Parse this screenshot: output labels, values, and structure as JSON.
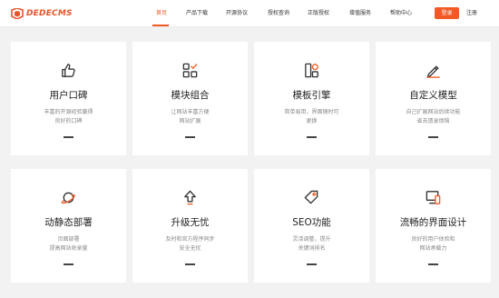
{
  "header": {
    "logo_text": "DEDECMS",
    "nav": [
      {
        "label": "首页",
        "active": true
      },
      {
        "label": "产品下载",
        "active": false
      },
      {
        "label": "开源协议",
        "active": false
      },
      {
        "label": "授权查询",
        "active": false
      },
      {
        "label": "正版授权",
        "active": false
      },
      {
        "label": "增值服务",
        "active": false
      },
      {
        "label": "帮助中心",
        "active": false
      }
    ],
    "login_label": "登录",
    "register_label": "注册"
  },
  "colors": {
    "accent": "#f15a24",
    "logo": "#e8542c",
    "background": "#f2f2f3",
    "card": "#ffffff"
  },
  "features": [
    {
      "icon": "thumbs-up-icon",
      "title": "用户口碑",
      "desc1": "丰富的开源经验赢得",
      "desc2": "良好的口碑"
    },
    {
      "icon": "modules-icon",
      "title": "模块组合",
      "desc1": "让网站丰富方便",
      "desc2": "网站扩展"
    },
    {
      "icon": "template-icon",
      "title": "模板引擎",
      "desc1": "简单易用，界面随时可",
      "desc2": "更换"
    },
    {
      "icon": "pencil-icon",
      "title": "自定义模型",
      "desc1": "自己扩展网站后续功能",
      "desc2": "省去遗录烦恼"
    },
    {
      "icon": "planet-icon",
      "title": "动静态部署",
      "desc1": "页面部署",
      "desc2": "提高网站收录量"
    },
    {
      "icon": "upgrade-icon",
      "title": "升级无忧",
      "desc1": "及时和官方程序同步",
      "desc2": "安全无忧"
    },
    {
      "icon": "seo-tag-icon",
      "title": "SEO功能",
      "desc1": "灵活调整，提升",
      "desc2": "关键词排名"
    },
    {
      "icon": "devices-icon",
      "title": "流畅的界面设计",
      "desc1": "良好的用户体验和",
      "desc2": "网站承载力"
    }
  ]
}
